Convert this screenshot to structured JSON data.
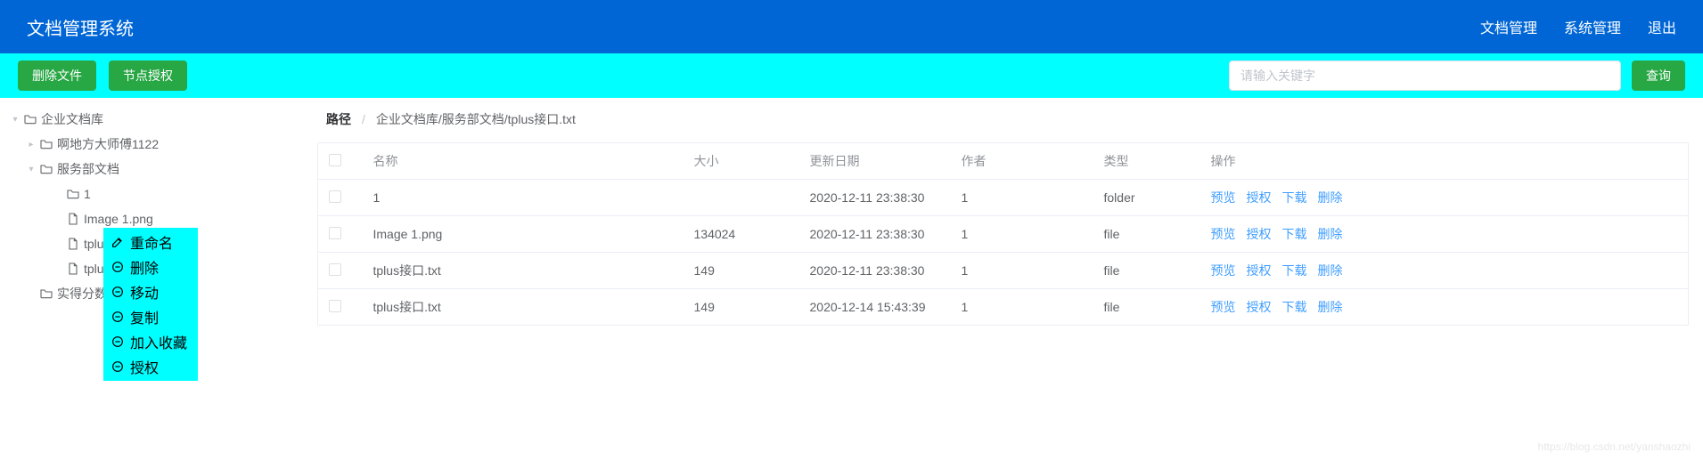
{
  "header": {
    "title": "文档管理系统",
    "nav": [
      "文档管理",
      "系统管理",
      "退出"
    ]
  },
  "toolbar": {
    "delete_file": "删除文件",
    "node_auth": "节点授权",
    "search_placeholder": "请输入关键字",
    "search_btn": "查询"
  },
  "tree": [
    {
      "level": 1,
      "expanded": true,
      "icon": "folder",
      "label": "企业文档库"
    },
    {
      "level": 2,
      "expanded": false,
      "icon": "folder",
      "label": "啊地方大师傅1122"
    },
    {
      "level": 2,
      "expanded": true,
      "icon": "folder",
      "label": "服务部文档"
    },
    {
      "level": 3,
      "expanded": null,
      "icon": "folder",
      "label": "1"
    },
    {
      "level": 3,
      "expanded": null,
      "icon": "file",
      "label": "Image 1.png"
    },
    {
      "level": 3,
      "expanded": null,
      "icon": "file",
      "label": "tplus接口.txt"
    },
    {
      "level": 3,
      "expanded": null,
      "icon": "file",
      "label": "tplus接口.txt"
    },
    {
      "level": 2,
      "expanded": null,
      "icon": "folder",
      "label": "实得分数"
    }
  ],
  "context_menu": [
    {
      "icon": "edit",
      "label": "重命名"
    },
    {
      "icon": "minus",
      "label": "删除"
    },
    {
      "icon": "minus",
      "label": "移动"
    },
    {
      "icon": "minus",
      "label": "复制"
    },
    {
      "icon": "minus",
      "label": "加入收藏"
    },
    {
      "icon": "minus",
      "label": "授权"
    }
  ],
  "breadcrumb": {
    "label": "路径",
    "path": "企业文档库/服务部文档/tplus接口.txt"
  },
  "table": {
    "columns": [
      "名称",
      "大小",
      "更新日期",
      "作者",
      "类型",
      "操作"
    ],
    "ops": [
      "预览",
      "授权",
      "下载",
      "删除"
    ],
    "rows": [
      {
        "name": "1",
        "size": "",
        "date": "2020-12-11 23:38:30",
        "author": "1",
        "type": "folder"
      },
      {
        "name": "Image 1.png",
        "size": "134024",
        "date": "2020-12-11 23:38:30",
        "author": "1",
        "type": "file"
      },
      {
        "name": "tplus接口.txt",
        "size": "149",
        "date": "2020-12-11 23:38:30",
        "author": "1",
        "type": "file"
      },
      {
        "name": "tplus接口.txt",
        "size": "149",
        "date": "2020-12-14 15:43:39",
        "author": "1",
        "type": "file"
      }
    ]
  },
  "watermark": "https://blog.csdn.net/yanshaozhi"
}
